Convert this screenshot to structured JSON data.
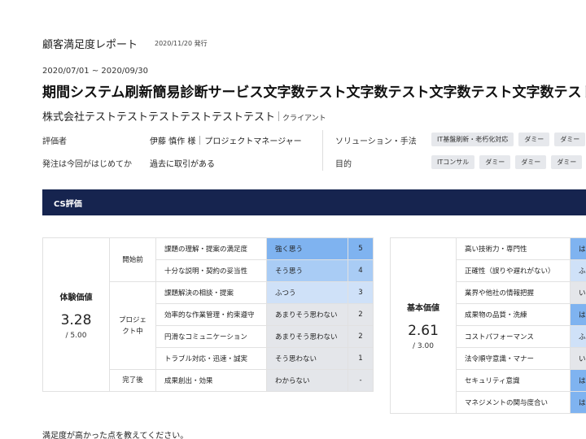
{
  "header": {
    "title": "顧客満足度レポート",
    "date": "2020/11/20  発行",
    "period": "2020/07/01 ~ 2020/09/30",
    "service_title": "期間システム刷新簡易診断サービス文字数テスト文字数テスト文字数テスト文字数テスト",
    "company": "株式会社テストテストテストテストテストテスト",
    "company_role": "クライアント"
  },
  "meta": {
    "evaluator_label": "評価者",
    "evaluator_name": "伊藤 慎作 様",
    "evaluator_role": "プロジェクトマネージャー",
    "order_label": "発注は今回がはじめてか",
    "order_value": "過去に取引がある",
    "solution_label": "ソリューション・手法",
    "solution_tags": [
      "IT基盤刷新・老朽化対応",
      "ダミー",
      "ダミー"
    ],
    "purpose_label": "目的",
    "purpose_tags": [
      "ITコンサル",
      "ダミー",
      "ダミー",
      "ダミー"
    ]
  },
  "section": {
    "title": "CS評価"
  },
  "experience": {
    "name": "体験価値",
    "score": "3.28",
    "max": "/ 5.00",
    "rows": [
      {
        "phase": "開始前",
        "item": "課題の理解・提案の満足度",
        "answer": "強く思う",
        "score": "5",
        "level": 5
      },
      {
        "phase": "",
        "item": "十分な説明・契約の妥当性",
        "answer": "そう思う",
        "score": "4",
        "level": 4
      },
      {
        "phase": "プロジェクト中",
        "item": "課題解決の相談・提案",
        "answer": "ふつう",
        "score": "3",
        "level": 3
      },
      {
        "phase": "",
        "item": "効率的な作業管理・約束遵守",
        "answer": "あまりそう思わない",
        "score": "2",
        "level": 2
      },
      {
        "phase": "",
        "item": "円滑なコミュニケーション",
        "answer": "あまりそう思わない",
        "score": "2",
        "level": 2
      },
      {
        "phase": "",
        "item": "トラブル対応・迅速・誠実",
        "answer": "そう思わない",
        "score": "1",
        "level": 1
      },
      {
        "phase": "完了後",
        "item": "成果創出・効果",
        "answer": "わからない",
        "score": "-",
        "level": 0
      }
    ],
    "phases": [
      "開始前",
      "プロジェ\nクト中",
      "完了後"
    ]
  },
  "basic": {
    "name": "基本価値",
    "score": "2.61",
    "max": "/ 3.00",
    "rows": [
      {
        "item": "高い技術力・専門性",
        "answer": "は",
        "level": 5
      },
      {
        "item": "正確性（誤りや遅れがない）",
        "answer": "ふ",
        "level": 3
      },
      {
        "item": "業界や他社の情報把握",
        "answer": "い",
        "level": 2
      },
      {
        "item": "成果物の品質・洗練",
        "answer": "は",
        "level": 5
      },
      {
        "item": "コストパフォーマンス",
        "answer": "ふ",
        "level": 3
      },
      {
        "item": "法令順守意識・マナー",
        "answer": "い",
        "level": 2
      },
      {
        "item": "セキュリティ意識",
        "answer": "は",
        "level": 5
      },
      {
        "item": "マネジメントの関与度合い",
        "answer": "は",
        "level": 5
      }
    ]
  },
  "footer": {
    "question": "満足度が高かった点を教えてください。"
  }
}
